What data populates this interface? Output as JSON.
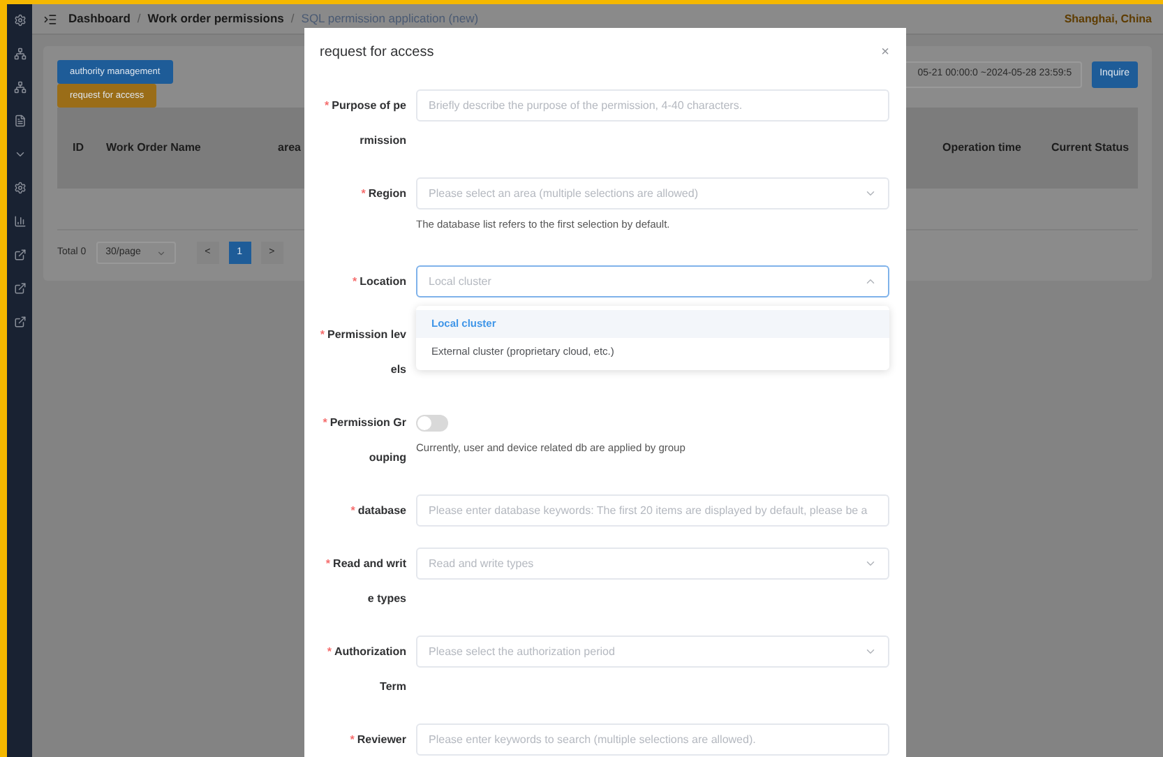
{
  "header": {
    "breadcrumb": [
      {
        "kind": "link",
        "label": "Dashboard"
      },
      {
        "kind": "separator",
        "label": "/"
      },
      {
        "kind": "link",
        "label": "Work order permissions"
      },
      {
        "kind": "separator",
        "label": "/"
      },
      {
        "kind": "current",
        "label": "SQL permission application (new)"
      }
    ],
    "location": "Shanghai, China"
  },
  "toolbar": {
    "buttons": [
      {
        "label": "authority management",
        "kind": "primary"
      },
      {
        "label": "request for access",
        "kind": "warning"
      }
    ],
    "date_range": "05-21 00:00:0 ~2024-05-28 23:59:5",
    "search_button": "Inquire"
  },
  "table": {
    "columns_left": [
      "ID",
      "Work Order Name",
      "area"
    ],
    "columns_right": [
      "Operation time",
      "Current Status"
    ]
  },
  "pagination": {
    "total": "Total 0",
    "page_size": "30/page",
    "prev": "<",
    "pages": [
      {
        "label": "1",
        "selected": true
      }
    ],
    "next": ">"
  },
  "dialog": {
    "title": "request for access",
    "close": "×",
    "rows": [
      {
        "label_lines": [
          "Purpose of pe",
          "rmission"
        ],
        "required_mark": "*",
        "field": {
          "kind": "input",
          "placeholder": "Briefly describe the purpose of the permission, 4-40 characters."
        }
      },
      {
        "label_lines": [
          "Region"
        ],
        "required_mark": "*",
        "field": {
          "kind": "select",
          "placeholder": "Please select an area (multiple selections are allowed)",
          "focused": false
        },
        "help": "The database list refers to the first selection by default."
      },
      {
        "label_lines": [
          "Location"
        ],
        "required_mark": "*",
        "field": {
          "kind": "select",
          "placeholder": "Local cluster",
          "focused": true
        },
        "dropdown": [
          {
            "label": "Local cluster",
            "selected": true
          },
          {
            "label": "External cluster (proprietary cloud, etc.)",
            "selected": false
          }
        ]
      },
      {
        "label_lines": [
          "Permission lev",
          "els"
        ],
        "required_mark": "*"
      },
      {
        "label_lines": [
          "Permission Gr",
          "ouping"
        ],
        "required_mark": "*",
        "field": {
          "kind": "switch",
          "on": false
        },
        "help": "Currently, user and device related db are applied by group"
      },
      {
        "label_lines": [
          "database"
        ],
        "required_mark": "*",
        "field": {
          "kind": "input",
          "placeholder": "Please enter database keywords: The first 20 items are displayed by default, please be a"
        }
      },
      {
        "label_lines": [
          "Read and writ",
          "e types"
        ],
        "required_mark": "*",
        "field": {
          "kind": "select",
          "placeholder": "Read and write types",
          "focused": false
        }
      },
      {
        "label_lines": [
          "Authorization",
          "Term"
        ],
        "required_mark": "*",
        "field": {
          "kind": "select",
          "placeholder": "Please select the authorization period",
          "focused": false
        }
      },
      {
        "label_lines": [
          "Reviewer"
        ],
        "required_mark": "*",
        "field": {
          "kind": "input",
          "placeholder": "Please enter keywords to search (multiple selections are allowed)."
        }
      }
    ]
  }
}
